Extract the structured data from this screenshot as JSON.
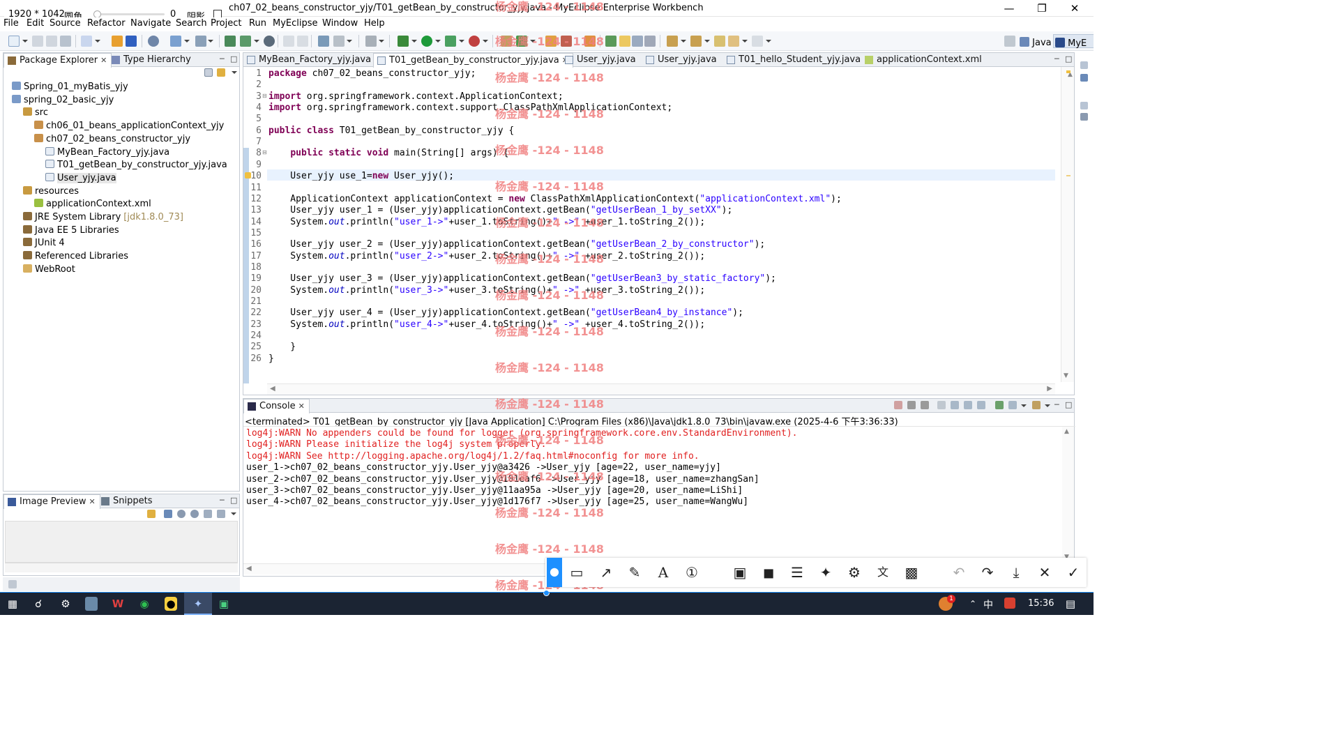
{
  "window": {
    "title": "ch07_02_beans_constructor_yjy/T01_getBean_by_constructor_yjy.java - MyEclipse Enterprise Workbench"
  },
  "capture_info": {
    "size": "1920 * 1042",
    "corner_label": "圆角",
    "corner_value": "0",
    "shadow_label": "阴影"
  },
  "menu": [
    "File",
    "Edit",
    "Source",
    "Refactor",
    "Navigate",
    "Search",
    "Project",
    "Run",
    "MyEclipse",
    "Window",
    "Help"
  ],
  "perspectives": {
    "java": "Java",
    "mye": "MyE"
  },
  "package_explorer": {
    "tabs": [
      {
        "label": "Package Explorer"
      },
      {
        "label": "Type Hierarchy"
      }
    ],
    "tree": [
      {
        "label": "Spring_01_myBatis_yjy",
        "deco": "",
        "icon": "project"
      },
      {
        "label": "spring_02_basic_yjy",
        "deco": "",
        "icon": "project"
      },
      {
        "label": "src",
        "deco": "",
        "icon": "srcfolder"
      },
      {
        "label": "ch06_01_beans_applicationContext_yjy",
        "deco": "",
        "icon": "package"
      },
      {
        "label": "ch07_02_beans_constructor_yjy",
        "deco": "",
        "icon": "package"
      },
      {
        "label": "MyBean_Factory_yjy.java",
        "deco": "",
        "icon": "java"
      },
      {
        "label": "T01_getBean_by_constructor_yjy.java",
        "deco": "",
        "icon": "java"
      },
      {
        "label": "User_yjy.java",
        "deco": "",
        "icon": "java"
      },
      {
        "label": "resources",
        "deco": "",
        "icon": "srcfolder"
      },
      {
        "label": "applicationContext.xml",
        "deco": "",
        "icon": "xml"
      },
      {
        "label": "JRE System Library",
        "deco": "[jdk1.8.0_73]",
        "icon": "library"
      },
      {
        "label": "Java EE 5 Libraries",
        "deco": "",
        "icon": "library"
      },
      {
        "label": "JUnit 4",
        "deco": "",
        "icon": "library"
      },
      {
        "label": "Referenced Libraries",
        "deco": "",
        "icon": "library"
      },
      {
        "label": "WebRoot",
        "deco": "",
        "icon": "folder"
      }
    ]
  },
  "image_preview": {
    "tabs": [
      {
        "label": "Image Preview"
      },
      {
        "label": "Snippets"
      }
    ]
  },
  "editor": {
    "tabs": [
      {
        "label": "MyBean_Factory_yjy.java"
      },
      {
        "label": "T01_getBean_by_constructor_yjy.java"
      },
      {
        "label": "User_yjy.java"
      },
      {
        "label": "User_yjy.java"
      },
      {
        "label": "T01_hello_Student_yjy.java"
      },
      {
        "label": "applicationContext.xml"
      }
    ],
    "lines": [
      "package ch07_02_beans_constructor_yjy;",
      "",
      "import org.springframework.context.ApplicationContext;",
      "import org.springframework.context.support.ClassPathXmlApplicationContext;",
      "",
      "public class T01_getBean_by_constructor_yjy {",
      "",
      "    public static void main(String[] args) {",
      "",
      "    User_yjy use_1=new User_yjy();",
      "",
      "    ApplicationContext applicationContext = new ClassPathXmlApplicationContext(\"applicationContext.xml\");",
      "    User_yjy user_1 = (User_yjy)applicationContext.getBean(\"getUserBean_1_by_setXX\");",
      "    System.out.println(\"user_1->\"+user_1.toString()+\" ->\" +user_1.toString_2());",
      "",
      "    User_yjy user_2 = (User_yjy)applicationContext.getBean(\"getUserBean_2_by_constructor\");",
      "    System.out.println(\"user_2->\"+user_2.toString()+\" ->\" +user_2.toString_2());",
      "",
      "    User_yjy user_3 = (User_yjy)applicationContext.getBean(\"getUserBean3_by_static_factory\");",
      "    System.out.println(\"user_3->\"+user_3.toString()+\" ->\" +user_3.toString_2());",
      "",
      "    User_yjy user_4 = (User_yjy)applicationContext.getBean(\"getUserBean4_by_instance\");",
      "    System.out.println(\"user_4->\"+user_4.toString()+\" ->\" +user_4.toString_2());",
      "",
      "    }",
      "}"
    ]
  },
  "console": {
    "tab_label": "Console",
    "header": "<terminated> T01_getBean_by_constructor_yjy [Java Application] C:\\Program Files (x86)\\Java\\jdk1.8.0_73\\bin\\javaw.exe (2025-4-6 下午3:36:33)",
    "lines": [
      {
        "text": "log4j:WARN No appenders could be found for logger (org.springframework.core.env.StandardEnvironment).",
        "warn": true
      },
      {
        "text": "log4j:WARN Please initialize the log4j system properly.",
        "warn": true
      },
      {
        "text": "log4j:WARN See http://logging.apache.org/log4j/1.2/faq.html#noconfig for more info.",
        "warn": true
      },
      {
        "text": "user_1->ch07_02_beans_constructor_yjy.User_yjy@a3426 ->User_yjy [age=22, user_name=yjy]",
        "warn": false
      },
      {
        "text": "user_2->ch07_02_beans_constructor_yjy.User_yjy@101eaf6 ->User_yjy [age=18, user_name=zhangSan]",
        "warn": false
      },
      {
        "text": "user_3->ch07_02_beans_constructor_yjy.User_yjy@11aa95a ->User_yjy [age=20, user_name=LiShi]",
        "warn": false
      },
      {
        "text": "user_4->ch07_02_beans_constructor_yjy.User_yjy@1d176f7 ->User_yjy [age=25, user_name=WangWu]",
        "warn": false
      }
    ]
  },
  "watermark": "杨金鹰 -124 - 1148",
  "taskbar": {
    "time": "15:36",
    "ime": "中",
    "notif_count": "1"
  },
  "capture_tools": [
    "pin-mode",
    "shape",
    "arrow",
    "pen",
    "text",
    "number",
    "mosaic",
    "fill",
    "stripe",
    "pin",
    "ocr",
    "translate",
    "text-recognize",
    "undo",
    "redo",
    "download",
    "close",
    "confirm"
  ]
}
